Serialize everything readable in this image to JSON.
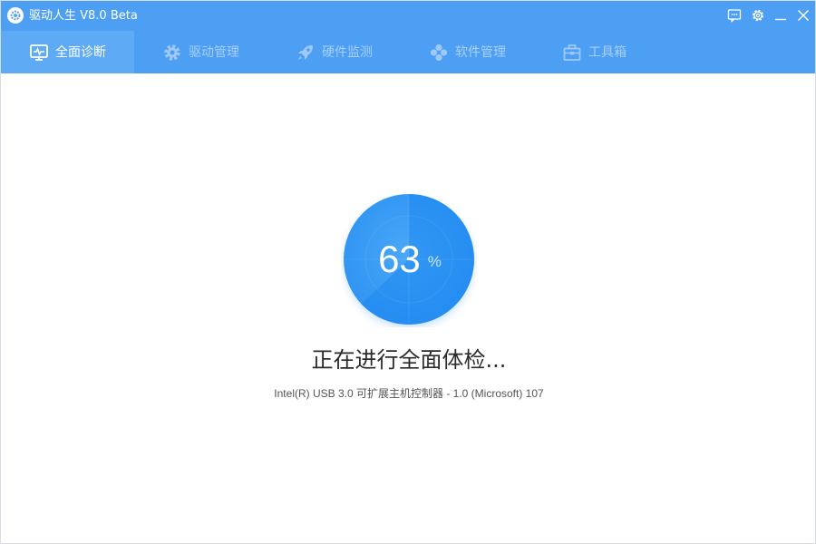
{
  "app": {
    "title": "驱动人生 V8.0 Beta",
    "logo_icon": "gear-logo-icon"
  },
  "window_controls": [
    {
      "name": "feedback-icon"
    },
    {
      "name": "settings-icon"
    },
    {
      "name": "minimize-icon"
    },
    {
      "name": "close-icon"
    }
  ],
  "nav": {
    "tabs": [
      {
        "label": "全面诊断",
        "icon": "monitor-pulse-icon",
        "active": true
      },
      {
        "label": "驱动管理",
        "icon": "gear-icon",
        "active": false
      },
      {
        "label": "硬件监测",
        "icon": "rocket-icon",
        "active": false
      },
      {
        "label": "软件管理",
        "icon": "flower-icon",
        "active": false
      },
      {
        "label": "工具箱",
        "icon": "toolbox-icon",
        "active": false
      }
    ]
  },
  "scan": {
    "progress": 63,
    "progress_unit": "%",
    "status_title": "正在进行全面体检...",
    "status_detail": "Intel(R) USB 3.0 可扩展主机控制器 - 1.0 (Microsoft) 107"
  },
  "colors": {
    "header_blue": "#4d9ff3",
    "active_tab_blue": "#5eaaf5",
    "progress_blue": "#3a9cf5",
    "progress_dark": "#2f8ff2"
  }
}
